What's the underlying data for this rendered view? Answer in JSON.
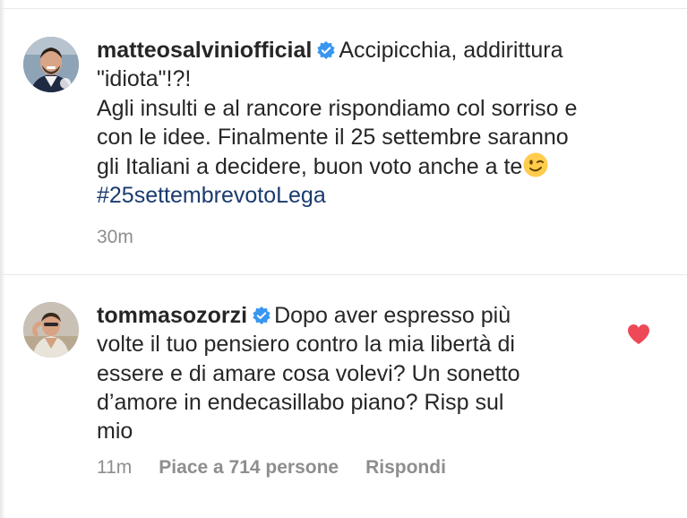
{
  "comments": [
    {
      "username": "matteosalviniofficial",
      "verified": true,
      "first_line": "Accipicchia, addirittura",
      "second_line": "\"idiota\"!?!",
      "body_lines": [
        "Agli insulti e al rancore rispondiamo col sorriso e",
        "con le idee. Finalmente il 25 settembre saranno",
        "gli Italiani a decidere, buon voto anche a te"
      ],
      "emoji": "winking-face",
      "hashtag": "#25settembrevotoLega",
      "time": "30m"
    },
    {
      "username": "tommasozorzi",
      "verified": true,
      "first_line": "Dopo aver espresso più",
      "body_lines": [
        "volte il tuo pensiero contro la mia libertà di",
        "essere e di amare cosa volevi? Un sonetto",
        "d’amore in endecasillabo piano? Risp sul",
        "mio"
      ],
      "time": "11m",
      "likes": "Piace a 714 persone",
      "reply": "Rispondi",
      "liked": true
    }
  ],
  "colors": {
    "text": "#262626",
    "meta": "#8e8e8e",
    "hashtag": "#1a3b6e",
    "verified_badge": "#3897f0",
    "heart": "#ed4956"
  },
  "icons": [
    "verified-badge-icon",
    "heart-icon",
    "winking-face-emoji"
  ]
}
